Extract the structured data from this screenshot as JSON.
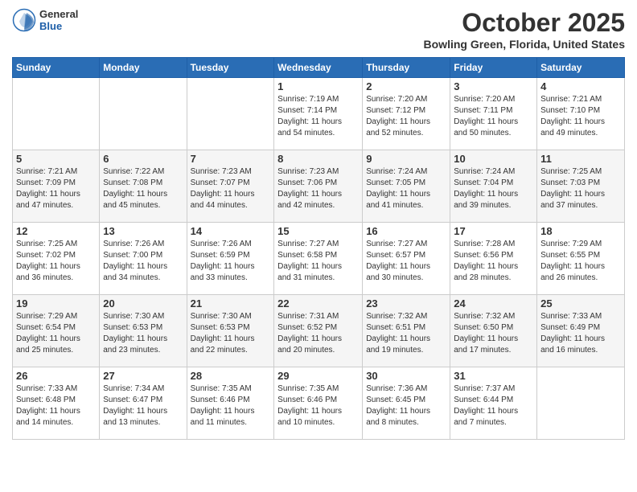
{
  "header": {
    "logo_general": "General",
    "logo_blue": "Blue",
    "month_title": "October 2025",
    "location": "Bowling Green, Florida, United States"
  },
  "weekdays": [
    "Sunday",
    "Monday",
    "Tuesday",
    "Wednesday",
    "Thursday",
    "Friday",
    "Saturday"
  ],
  "weeks": [
    [
      {
        "day": "",
        "info": ""
      },
      {
        "day": "",
        "info": ""
      },
      {
        "day": "",
        "info": ""
      },
      {
        "day": "1",
        "info": "Sunrise: 7:19 AM\nSunset: 7:14 PM\nDaylight: 11 hours\nand 54 minutes."
      },
      {
        "day": "2",
        "info": "Sunrise: 7:20 AM\nSunset: 7:12 PM\nDaylight: 11 hours\nand 52 minutes."
      },
      {
        "day": "3",
        "info": "Sunrise: 7:20 AM\nSunset: 7:11 PM\nDaylight: 11 hours\nand 50 minutes."
      },
      {
        "day": "4",
        "info": "Sunrise: 7:21 AM\nSunset: 7:10 PM\nDaylight: 11 hours\nand 49 minutes."
      }
    ],
    [
      {
        "day": "5",
        "info": "Sunrise: 7:21 AM\nSunset: 7:09 PM\nDaylight: 11 hours\nand 47 minutes."
      },
      {
        "day": "6",
        "info": "Sunrise: 7:22 AM\nSunset: 7:08 PM\nDaylight: 11 hours\nand 45 minutes."
      },
      {
        "day": "7",
        "info": "Sunrise: 7:23 AM\nSunset: 7:07 PM\nDaylight: 11 hours\nand 44 minutes."
      },
      {
        "day": "8",
        "info": "Sunrise: 7:23 AM\nSunset: 7:06 PM\nDaylight: 11 hours\nand 42 minutes."
      },
      {
        "day": "9",
        "info": "Sunrise: 7:24 AM\nSunset: 7:05 PM\nDaylight: 11 hours\nand 41 minutes."
      },
      {
        "day": "10",
        "info": "Sunrise: 7:24 AM\nSunset: 7:04 PM\nDaylight: 11 hours\nand 39 minutes."
      },
      {
        "day": "11",
        "info": "Sunrise: 7:25 AM\nSunset: 7:03 PM\nDaylight: 11 hours\nand 37 minutes."
      }
    ],
    [
      {
        "day": "12",
        "info": "Sunrise: 7:25 AM\nSunset: 7:02 PM\nDaylight: 11 hours\nand 36 minutes."
      },
      {
        "day": "13",
        "info": "Sunrise: 7:26 AM\nSunset: 7:00 PM\nDaylight: 11 hours\nand 34 minutes."
      },
      {
        "day": "14",
        "info": "Sunrise: 7:26 AM\nSunset: 6:59 PM\nDaylight: 11 hours\nand 33 minutes."
      },
      {
        "day": "15",
        "info": "Sunrise: 7:27 AM\nSunset: 6:58 PM\nDaylight: 11 hours\nand 31 minutes."
      },
      {
        "day": "16",
        "info": "Sunrise: 7:27 AM\nSunset: 6:57 PM\nDaylight: 11 hours\nand 30 minutes."
      },
      {
        "day": "17",
        "info": "Sunrise: 7:28 AM\nSunset: 6:56 PM\nDaylight: 11 hours\nand 28 minutes."
      },
      {
        "day": "18",
        "info": "Sunrise: 7:29 AM\nSunset: 6:55 PM\nDaylight: 11 hours\nand 26 minutes."
      }
    ],
    [
      {
        "day": "19",
        "info": "Sunrise: 7:29 AM\nSunset: 6:54 PM\nDaylight: 11 hours\nand 25 minutes."
      },
      {
        "day": "20",
        "info": "Sunrise: 7:30 AM\nSunset: 6:53 PM\nDaylight: 11 hours\nand 23 minutes."
      },
      {
        "day": "21",
        "info": "Sunrise: 7:30 AM\nSunset: 6:53 PM\nDaylight: 11 hours\nand 22 minutes."
      },
      {
        "day": "22",
        "info": "Sunrise: 7:31 AM\nSunset: 6:52 PM\nDaylight: 11 hours\nand 20 minutes."
      },
      {
        "day": "23",
        "info": "Sunrise: 7:32 AM\nSunset: 6:51 PM\nDaylight: 11 hours\nand 19 minutes."
      },
      {
        "day": "24",
        "info": "Sunrise: 7:32 AM\nSunset: 6:50 PM\nDaylight: 11 hours\nand 17 minutes."
      },
      {
        "day": "25",
        "info": "Sunrise: 7:33 AM\nSunset: 6:49 PM\nDaylight: 11 hours\nand 16 minutes."
      }
    ],
    [
      {
        "day": "26",
        "info": "Sunrise: 7:33 AM\nSunset: 6:48 PM\nDaylight: 11 hours\nand 14 minutes."
      },
      {
        "day": "27",
        "info": "Sunrise: 7:34 AM\nSunset: 6:47 PM\nDaylight: 11 hours\nand 13 minutes."
      },
      {
        "day": "28",
        "info": "Sunrise: 7:35 AM\nSunset: 6:46 PM\nDaylight: 11 hours\nand 11 minutes."
      },
      {
        "day": "29",
        "info": "Sunrise: 7:35 AM\nSunset: 6:46 PM\nDaylight: 11 hours\nand 10 minutes."
      },
      {
        "day": "30",
        "info": "Sunrise: 7:36 AM\nSunset: 6:45 PM\nDaylight: 11 hours\nand 8 minutes."
      },
      {
        "day": "31",
        "info": "Sunrise: 7:37 AM\nSunset: 6:44 PM\nDaylight: 11 hours\nand 7 minutes."
      },
      {
        "day": "",
        "info": ""
      }
    ]
  ]
}
